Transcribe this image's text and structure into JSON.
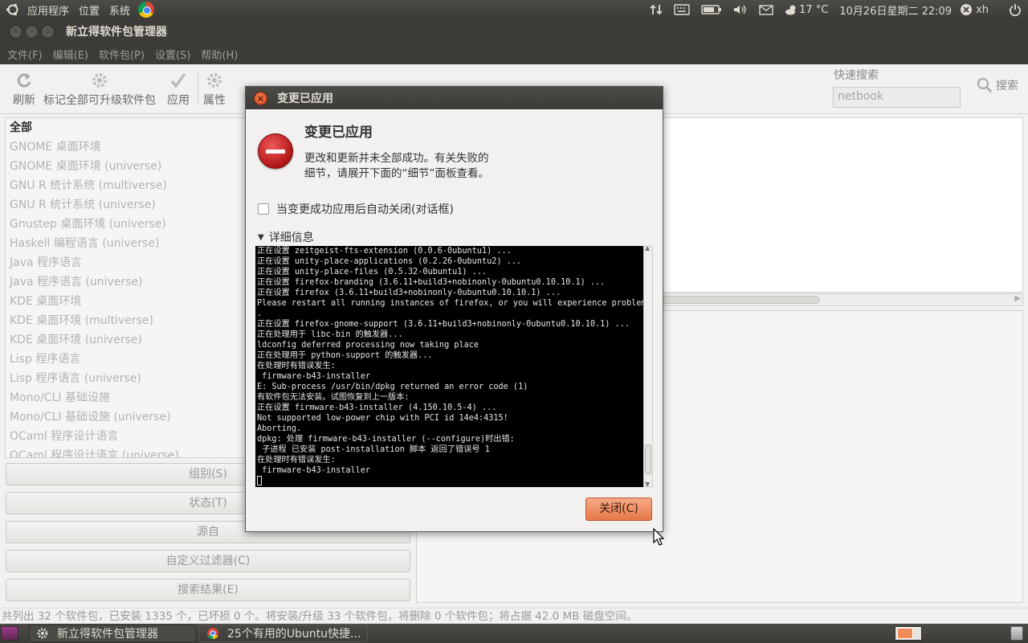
{
  "top_panel": {
    "menus": [
      "应用程序",
      "位置",
      "系统"
    ],
    "weather": "17 °C",
    "clock": "10月26日星期二 22:09",
    "user": "xh"
  },
  "window": {
    "title": "新立得软件包管理器",
    "menubar": [
      "文件(F)",
      "编辑(E)",
      "软件包(P)",
      "设置(S)",
      "帮助(H)"
    ],
    "toolbar": {
      "reload": "刷新",
      "mark_all": "标记全部可升级软件包",
      "apply": "应用",
      "properties": "属性",
      "quick_search_label": "快速搜索",
      "quick_search_value": "netbook",
      "search": "搜索"
    },
    "categories": [
      "全部",
      "GNOME 桌面环境",
      "GNOME 桌面环境 (universe)",
      "GNU R 统计系统 (multiverse)",
      "GNU R 统计系统 (universe)",
      "Gnustep 桌面环境 (universe)",
      "Haskell 编程语言 (universe)",
      "Java 程序语言",
      "Java 程序语言 (universe)",
      "KDE 桌面环境",
      "KDE 桌面环境 (multiverse)",
      "KDE 桌面环境 (universe)",
      "Lisp 程序语言",
      "Lisp 程序语言 (universe)",
      "Mono/CLI 基础设施",
      "Mono/CLI 基础设施 (universe)",
      "OCaml 程序设计语言",
      "OCaml 程序设计语言 (universe)"
    ],
    "filter_buttons": {
      "sections": "组别(S)",
      "status": "状态(T)",
      "origin": "源自",
      "custom": "自定义过滤器(C)",
      "search_results": "搜索结果(E)"
    },
    "status_bar": "共列出 32 个软件包，已安装 1335 个，已坏损 0 个。将安装/升级 33 个软件包，将删除 0 个软件包；将占据 42.0 MB 磁盘空间。"
  },
  "dialog": {
    "title": "变更已应用",
    "heading": "变更已应用",
    "message_line1": "更改和更新并未全部成功。有关失败的",
    "message_line2": "细节，请展开下面的“细节”面板查看。",
    "checkbox_label": "当变更成功应用后自动关闭(对话框)",
    "checkbox_checked": false,
    "details_label": "详细信息",
    "terminal_lines": [
      "正在设置 zeitgeist-fts-extension (0.0.6-0ubuntu1) ...",
      "正在设置 unity-place-applications (0.2.26-0ubuntu2) ...",
      "正在设置 unity-place-files (0.5.32-0ubuntu1) ...",
      "正在设置 firefox-branding (3.6.11+build3+nobinonly-0ubuntu0.10.10.1) ...",
      "正在设置 firefox (3.6.11+build3+nobinonly-0ubuntu0.10.10.1) ...",
      "Please restart all running instances of firefox, or you will experience problems",
      ".",
      "正在设置 firefox-gnome-support (3.6.11+build3+nobinonly-0ubuntu0.10.10.1) ...",
      "正在处理用于 libc-bin 的触发器...",
      "ldconfig deferred processing now taking place",
      "正在处理用于 python-support 的触发器...",
      "在处理时有错误发生:",
      " firmware-b43-installer",
      "E: Sub-process /usr/bin/dpkg returned an error code (1)",
      "有软件包无法安装。试图恢复到上一版本:",
      "正在设置 firmware-b43-installer (4.150.10.5-4) ...",
      "Not supported low-power chip with PCI id 14e4:4315!",
      "Aborting.",
      "dpkg: 处理 firmware-b43-installer (--configure)时出错:",
      " 子进程 已安装 post-installation 脚本 返回了错误号 1",
      "在处理时有错误发生:",
      " firmware-b43-installer"
    ],
    "close_button": "关闭(C)"
  },
  "taskbar": {
    "tasks": [
      "新立得软件包管理器",
      "25个有用的Ubuntu快捷..."
    ]
  },
  "colors": {
    "panel": "#3c3b37",
    "accent": "#e7784a",
    "error": "#b01515"
  }
}
